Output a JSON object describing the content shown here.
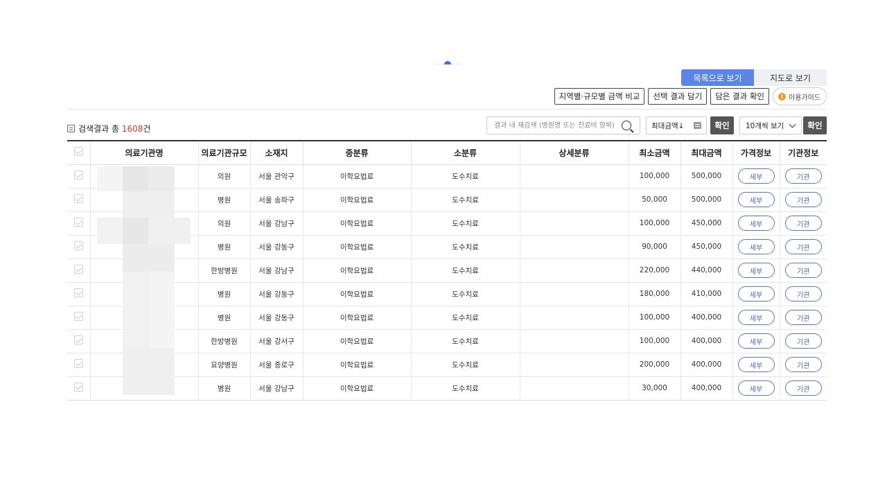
{
  "view_toggle": {
    "list_label": "목록으로 보기",
    "map_label": "지도로 보기"
  },
  "actions": {
    "compare_label": "지역별·규모별 금액 비교",
    "save_label": "선택 결과 담기",
    "check_label": "담은 결과 확인",
    "guide_label": "이용가이드"
  },
  "result": {
    "prefix": "검색결과 총 ",
    "count": "1608",
    "suffix": "건"
  },
  "search": {
    "placeholder": "결과 내 재검색 (병원명 또는 진료비 항목)"
  },
  "sort": {
    "value": "최대금액↓",
    "confirm_label": "확인"
  },
  "perpage": {
    "value": "10개씩 보기",
    "confirm_label": "확인"
  },
  "table": {
    "headers": [
      "",
      "의료기관명",
      "의료기관규모",
      "소재지",
      "중분류",
      "소분류",
      "상세분류",
      "최소금액",
      "최대금액",
      "가격정보",
      "기관정보"
    ],
    "detail_label": "세부",
    "org_label": "기관",
    "rows": [
      {
        "name": "",
        "scale": "의원",
        "location": "서울 관악구",
        "mid": "이학요법료",
        "sub": "도수치료",
        "detail": "",
        "min": "100,000",
        "max": "500,000"
      },
      {
        "name": "",
        "scale": "병원",
        "location": "서울 송파구",
        "mid": "이학요법료",
        "sub": "도수치료",
        "detail": "",
        "min": "50,000",
        "max": "500,000"
      },
      {
        "name": "",
        "scale": "의원",
        "location": "서울 강남구",
        "mid": "이학요법료",
        "sub": "도수치료",
        "detail": "",
        "min": "100,000",
        "max": "450,000"
      },
      {
        "name": "",
        "scale": "병원",
        "location": "서울 강동구",
        "mid": "이학요법료",
        "sub": "도수치료",
        "detail": "",
        "min": "90,000",
        "max": "450,000"
      },
      {
        "name": "",
        "scale": "한방병원",
        "location": "서울 강남구",
        "mid": "이학요법료",
        "sub": "도수치료",
        "detail": "",
        "min": "220,000",
        "max": "440,000"
      },
      {
        "name": "",
        "scale": "병원",
        "location": "서울 강동구",
        "mid": "이학요법료",
        "sub": "도수치료",
        "detail": "",
        "min": "180,000",
        "max": "410,000"
      },
      {
        "name": "",
        "scale": "병원",
        "location": "서울 강동구",
        "mid": "이학요법료",
        "sub": "도수치료",
        "detail": "",
        "min": "100,000",
        "max": "400,000"
      },
      {
        "name": "",
        "scale": "한방병원",
        "location": "서울 강서구",
        "mid": "이학요법료",
        "sub": "도수치료",
        "detail": "",
        "min": "100,000",
        "max": "400,000"
      },
      {
        "name": "",
        "scale": "요양병원",
        "location": "서울 종로구",
        "mid": "이학요법료",
        "sub": "도수치료",
        "detail": "",
        "min": "200,000",
        "max": "400,000"
      },
      {
        "name": "",
        "scale": "병원",
        "location": "서울 강남구",
        "mid": "이학요법료",
        "sub": "도수치료",
        "detail": "",
        "min": "30,000",
        "max": "400,000"
      }
    ]
  },
  "colors": {
    "accent": "#5c86e6",
    "count": "#c0392b",
    "pill_border": "#5478c8",
    "dark_button": "#555555"
  }
}
